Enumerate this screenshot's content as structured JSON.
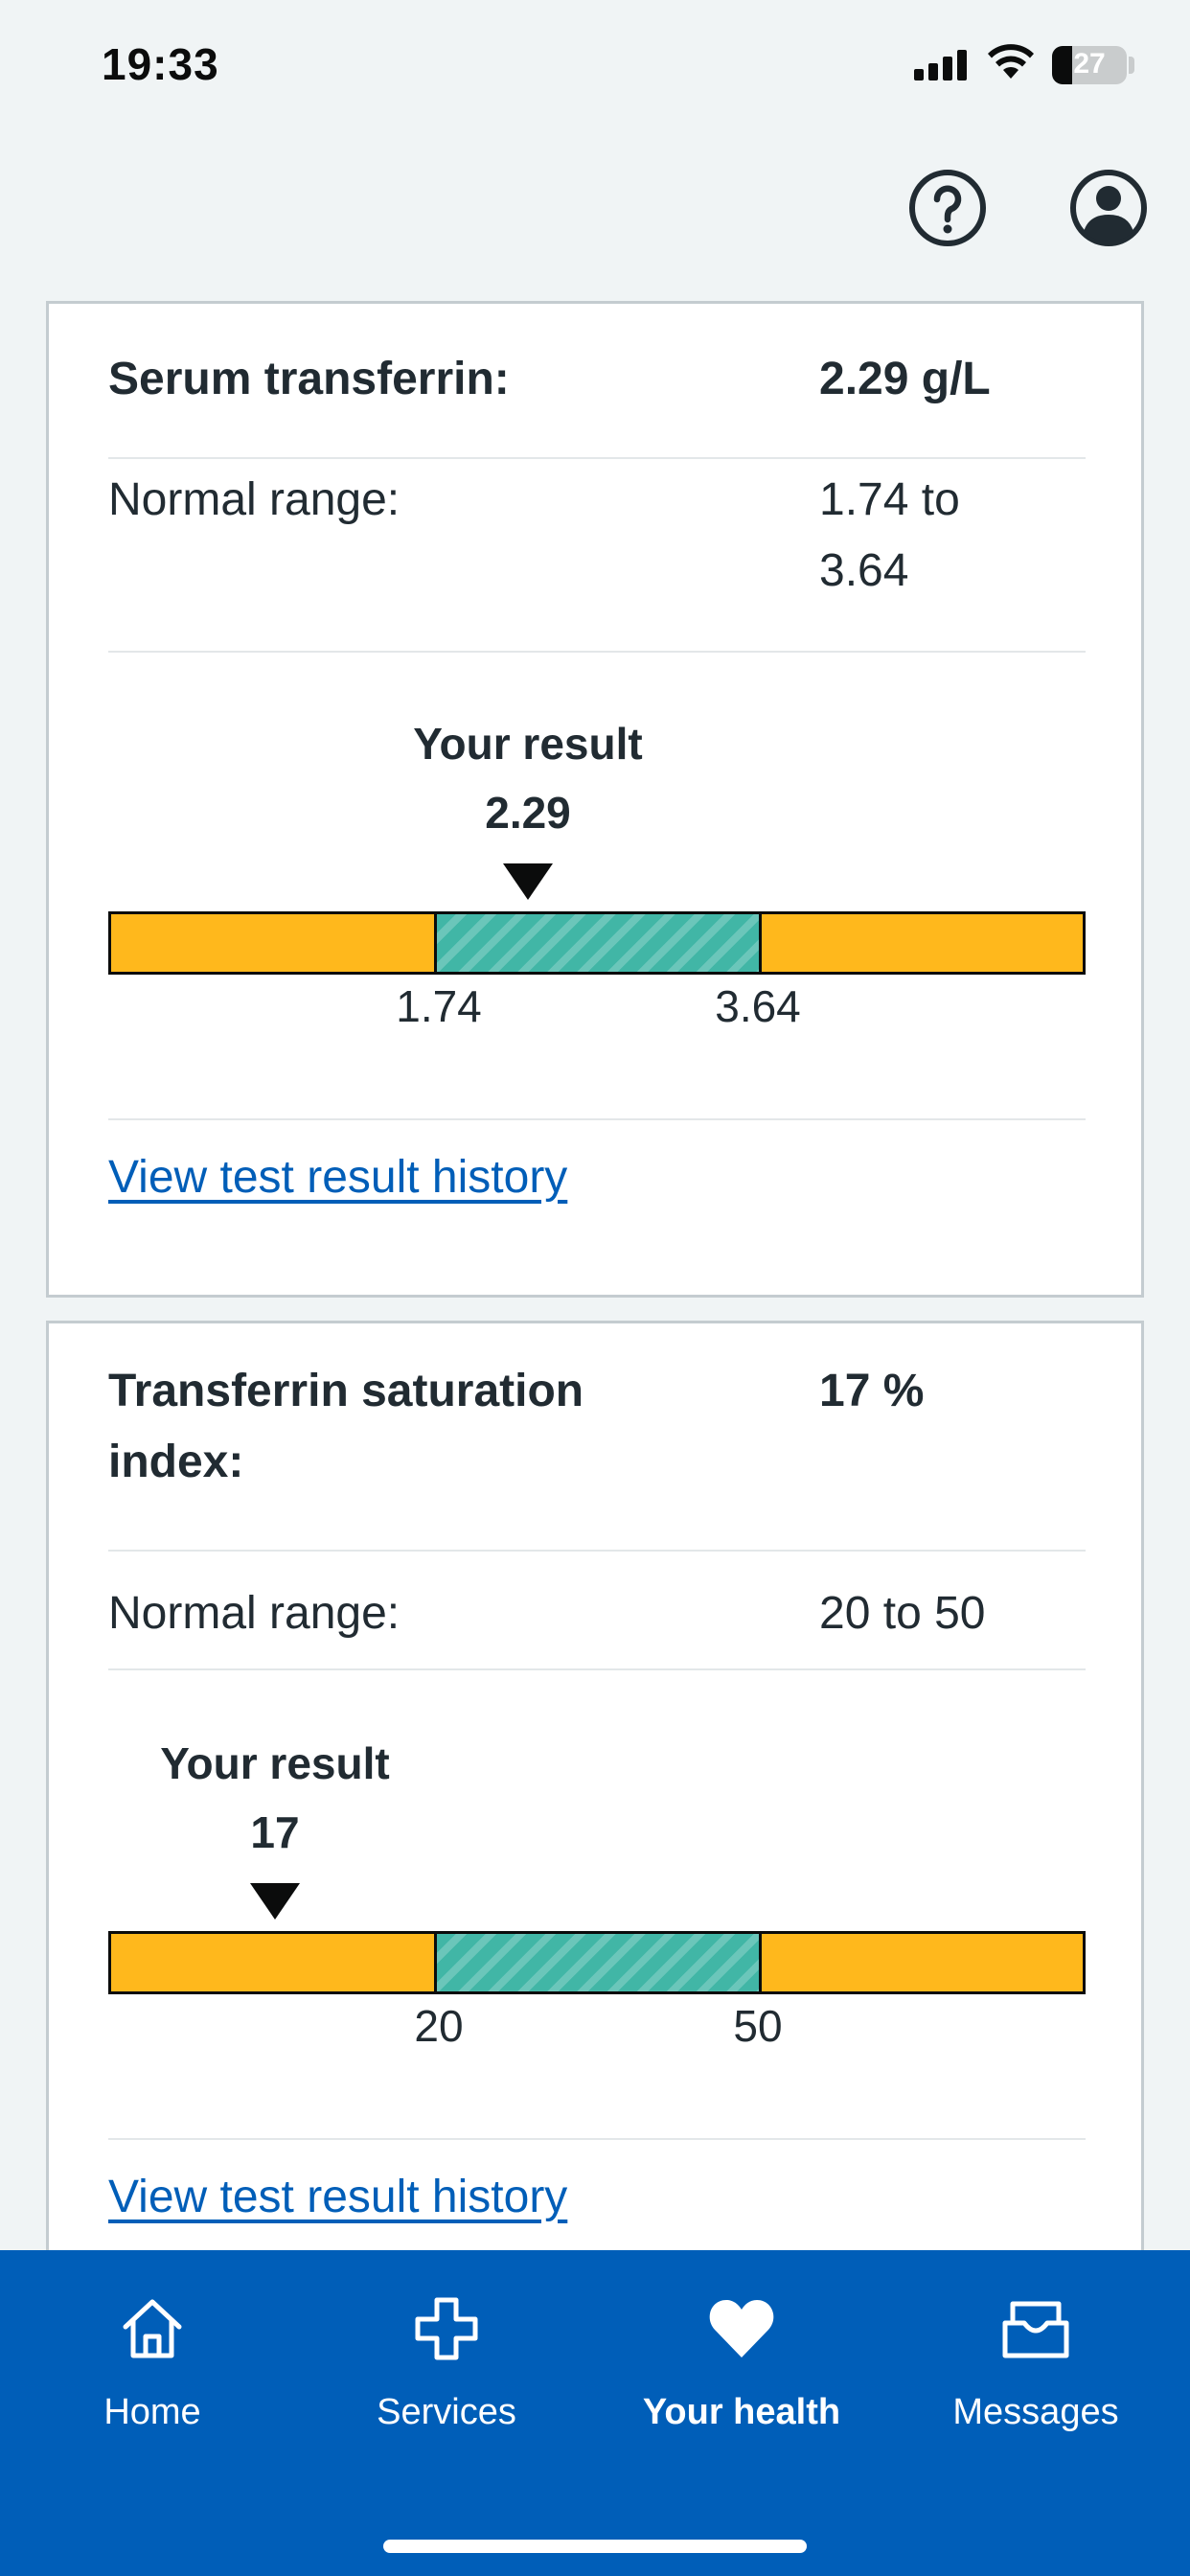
{
  "status_bar": {
    "time": "19:33",
    "battery": "27"
  },
  "cards": [
    {
      "label": "Serum transferrin:",
      "value": "2.29 g/L",
      "range_label": "Normal range:",
      "range_value": "1.74 to 3.64",
      "your_result_label": "Your result",
      "result": "2.29",
      "low": "1.74",
      "high": "3.64",
      "history_link": "View test result history"
    },
    {
      "label": "Transferrin saturation index:",
      "value": "17 %",
      "range_label": "Normal range:",
      "range_value": "20 to 50",
      "your_result_label": "Your result",
      "result": "17",
      "low": "20",
      "high": "50",
      "history_link": "View test result history"
    }
  ],
  "nav": [
    {
      "label": "Home",
      "icon": "home-icon"
    },
    {
      "label": "Services",
      "icon": "cross-icon"
    },
    {
      "label": "Your health",
      "icon": "heart-icon",
      "active": true
    },
    {
      "label": "Messages",
      "icon": "inbox-icon"
    }
  ],
  "colors": {
    "nav": "#005eb8",
    "out_of_range": "#ffb81c",
    "normal": "#41b6a6",
    "link": "#005eb8"
  }
}
